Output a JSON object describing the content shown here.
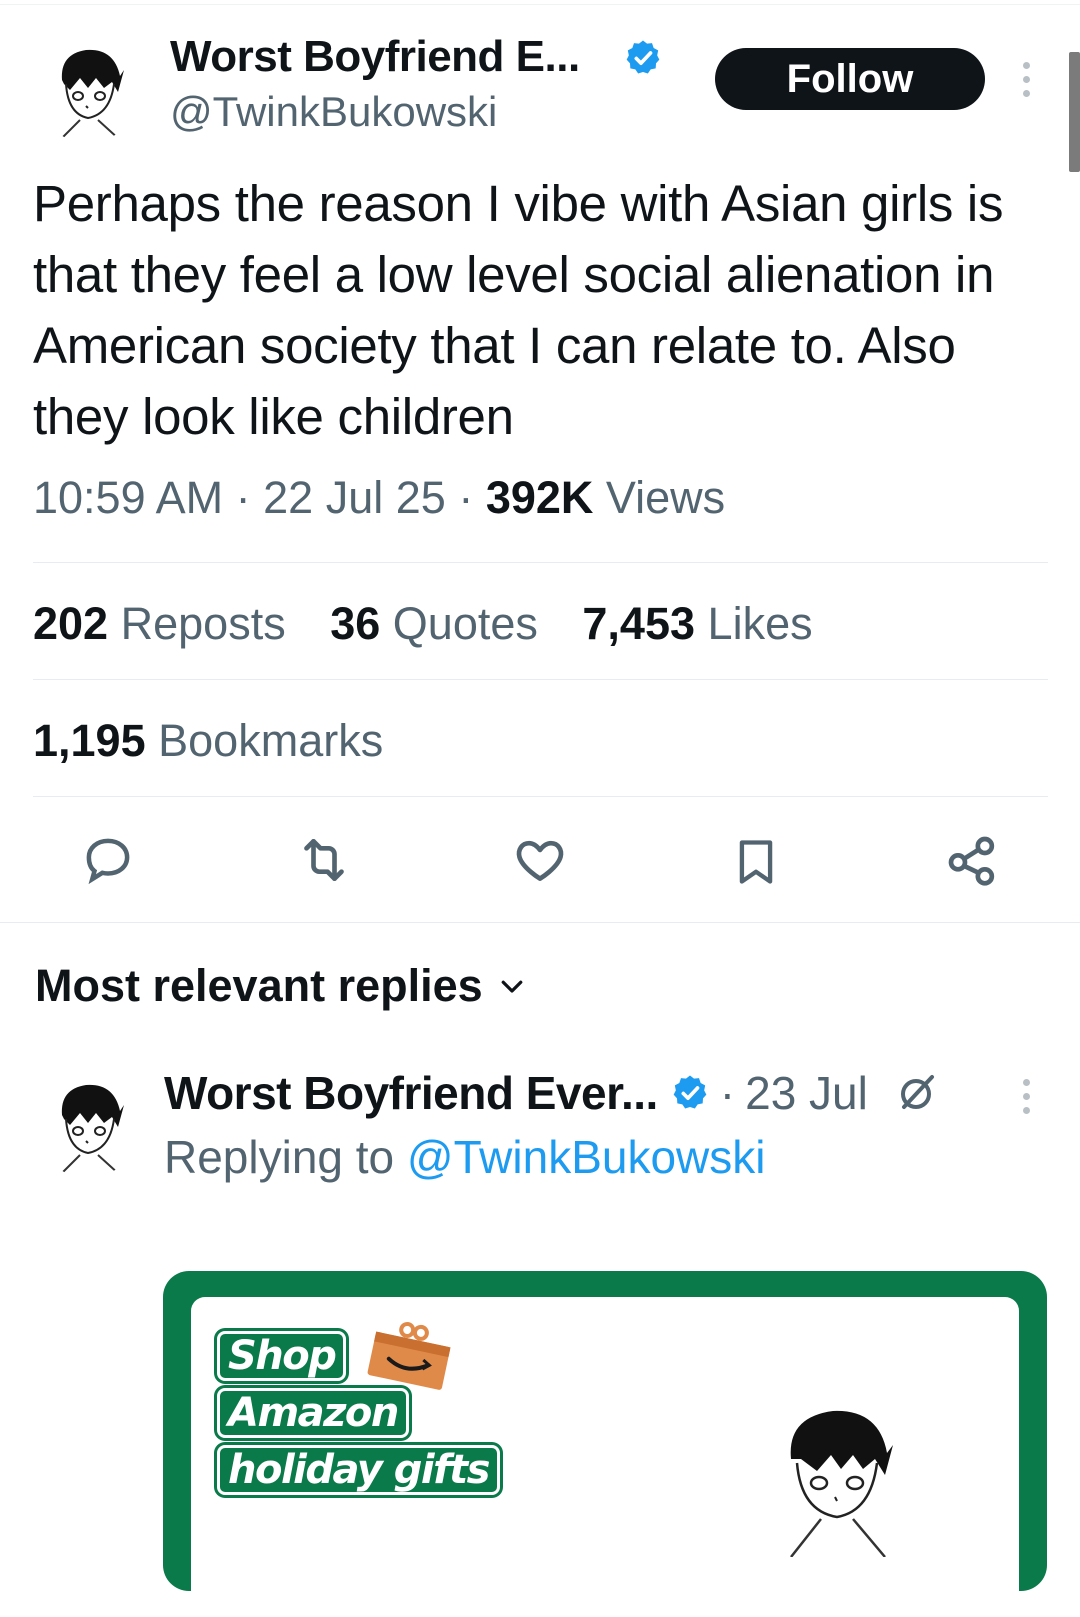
{
  "tweet": {
    "author_name": "Worst Boyfriend E...",
    "author_handle": "@TwinkBukowski",
    "follow_label": "Follow",
    "text": "Perhaps the reason I vibe with Asian girls is that they feel a low level social alienation in American society that I can relate to. Also they look like children",
    "time": "10:59 AM",
    "date": "22 Jul 25",
    "views_count": "392K",
    "views_label": "Views"
  },
  "stats": {
    "reposts_count": "202",
    "reposts_label": "Reposts",
    "quotes_count": "36",
    "quotes_label": "Quotes",
    "likes_count": "7,453",
    "likes_label": "Likes",
    "bookmarks_count": "1,195",
    "bookmarks_label": "Bookmarks"
  },
  "actions": [
    "reply-icon",
    "repost-icon",
    "like-icon",
    "bookmark-icon",
    "share-icon"
  ],
  "replies": {
    "header": "Most relevant replies",
    "items": [
      {
        "author_name": "Worst Boyfriend Ever...",
        "date": "23 Jul",
        "replying_prefix": "Replying to",
        "replying_handle": "@TwinkBukowski"
      }
    ]
  },
  "ad": {
    "line1": "Shop",
    "line2": "Amazon",
    "line3": "holiday gifts"
  },
  "colors": {
    "text": "#0f1419",
    "secondary": "#536471",
    "link": "#1d9bf0",
    "verified": "#1d9bf0",
    "ad_green": "#0a7a4a"
  }
}
